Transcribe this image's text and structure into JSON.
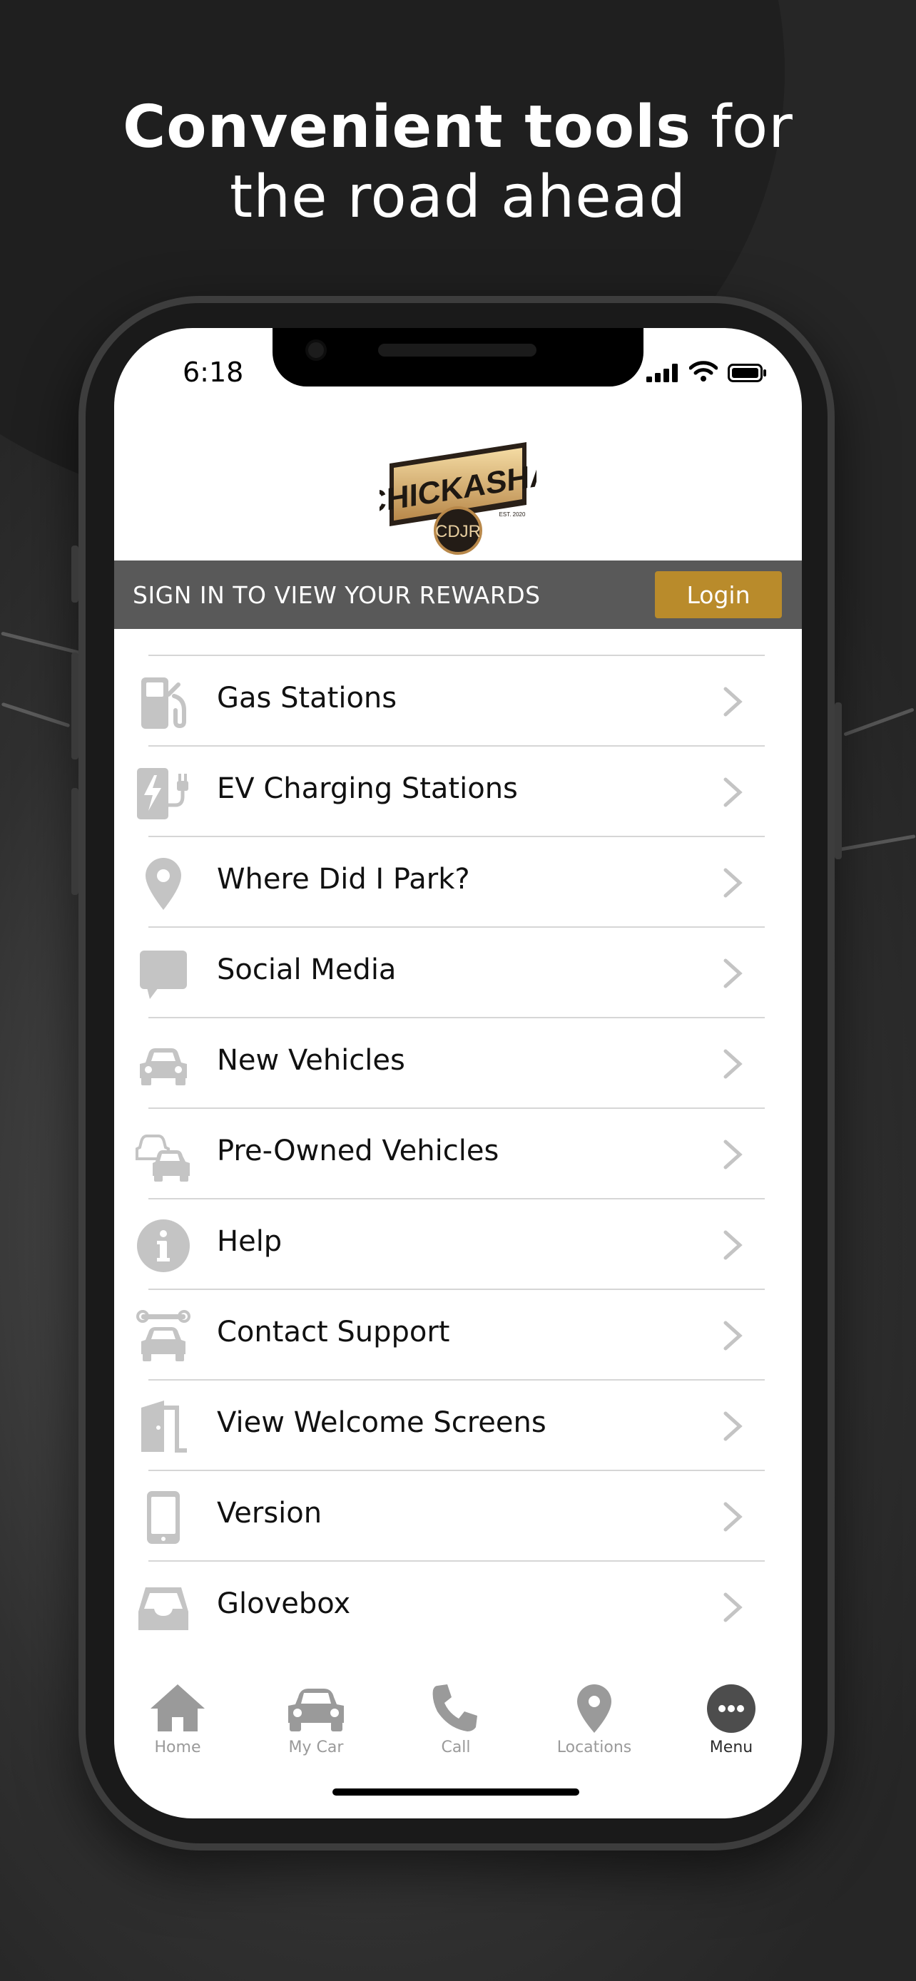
{
  "headline": {
    "bold": "Convenient tools",
    "rest1": " for",
    "line2": "the road ahead"
  },
  "status": {
    "time": "6:18"
  },
  "logo": {
    "name": "CHICKASHA",
    "sub": "CDJR",
    "est": "EST. 2020"
  },
  "rewards": {
    "text": "SIGN IN TO VIEW YOUR REWARDS",
    "login_label": "Login"
  },
  "menu": [
    {
      "label": "Gas Stations",
      "icon": "gas-pump-icon"
    },
    {
      "label": "EV Charging Stations",
      "icon": "ev-charger-icon"
    },
    {
      "label": "Where Did I Park?",
      "icon": "map-pin-icon"
    },
    {
      "label": "Social Media",
      "icon": "chat-bubble-icon"
    },
    {
      "label": "New Vehicles",
      "icon": "car-icon"
    },
    {
      "label": "Pre-Owned Vehicles",
      "icon": "cars-icon"
    },
    {
      "label": "Help",
      "icon": "info-icon"
    },
    {
      "label": "Contact Support",
      "icon": "wrench-car-icon"
    },
    {
      "label": "View Welcome Screens",
      "icon": "door-icon"
    },
    {
      "label": "Version",
      "icon": "phone-icon"
    },
    {
      "label": "Glovebox",
      "icon": "tray-icon"
    }
  ],
  "tabs": [
    {
      "label": "Home",
      "icon": "home-icon"
    },
    {
      "label": "My Car",
      "icon": "car-icon"
    },
    {
      "label": "Call",
      "icon": "phone-call-icon"
    },
    {
      "label": "Locations",
      "icon": "map-pin-icon"
    },
    {
      "label": "Menu",
      "icon": "more-icon",
      "active": true
    }
  ],
  "colors": {
    "accent": "#b98b2b",
    "bar": "#595959",
    "icon_gray": "#c4c4c4"
  }
}
